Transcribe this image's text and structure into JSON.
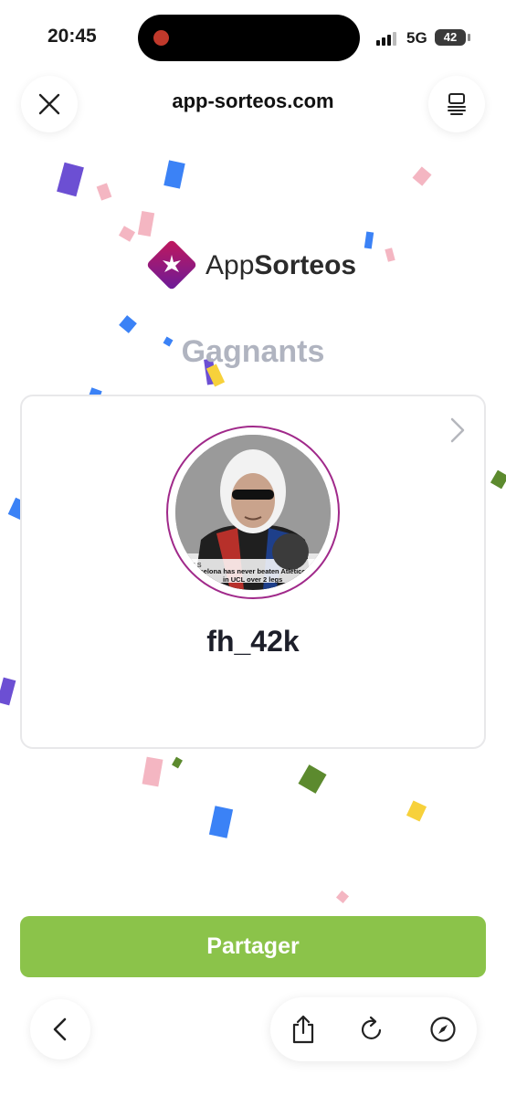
{
  "status_bar": {
    "time": "20:45",
    "network": "5G",
    "battery": "42"
  },
  "browser": {
    "url": "app-sorteos.com",
    "close_icon": "close-icon",
    "tabs_icon": "tabs-icon"
  },
  "logo": {
    "text_regular": "App",
    "text_bold": "Sorteos"
  },
  "page": {
    "title": "Gagnants"
  },
  "winner": {
    "username": "fh_42k",
    "photo_caption_line1": "Barcelona has never beaten Atletico",
    "photo_caption_line2": "in UCL over 2 legs",
    "photo_tag": "FINALS"
  },
  "actions": {
    "share_label": "Partager"
  },
  "colors": {
    "accent_green": "#8bc34a",
    "title_gray": "#b0b4c0",
    "avatar_ring": "#a0298a"
  },
  "toolbar": {
    "back_icon": "back-icon",
    "share_icon": "share-icon",
    "reload_icon": "reload-icon",
    "compass_icon": "compass-icon"
  }
}
